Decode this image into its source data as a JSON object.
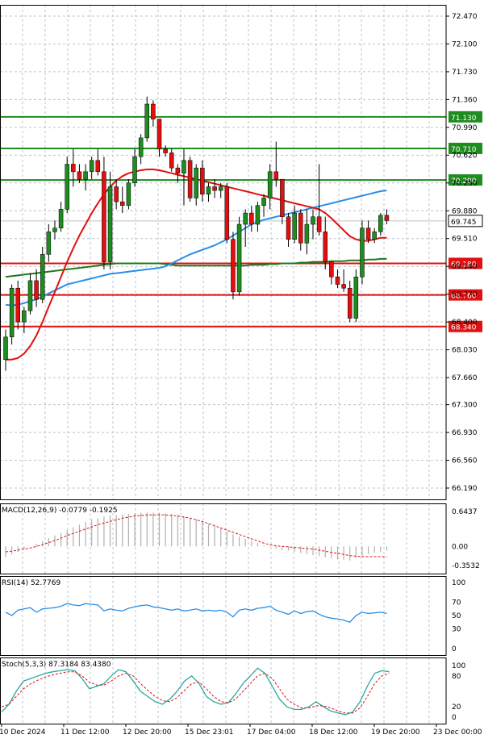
{
  "chart_data": {
    "type": "candlestick",
    "main": {
      "ylim": [
        66.19,
        72.47
      ],
      "y_ticks": [
        "72.470",
        "72.100",
        "71.730",
        "71.360",
        "70.990",
        "70.620",
        "70.250",
        "69.880",
        "69.510",
        "69.140",
        "68.770",
        "68.400",
        "68.030",
        "67.660",
        "67.300",
        "66.930",
        "66.560",
        "66.190"
      ],
      "x_labels": [
        "10 Dec 2024",
        "11 Dec 12:00",
        "12 Dec 20:00",
        "15 Dec 23:01",
        "17 Dec 04:00",
        "18 Dec 12:00",
        "19 Dec 20:00",
        "23 Dec 00:00"
      ],
      "x_label_index": [
        0,
        11,
        22,
        33,
        44,
        55,
        66,
        77
      ],
      "current_price": "69.745",
      "levels": [
        {
          "label": "71.130",
          "value": 71.13,
          "color": "#1e8c1e"
        },
        {
          "label": "70.710",
          "value": 70.71,
          "color": "#1e8c1e"
        },
        {
          "label": "70.290",
          "value": 70.29,
          "color": "#1e8c1e"
        },
        {
          "label": "69.180",
          "value": 69.18,
          "color": "#e01010"
        },
        {
          "label": "68.760",
          "value": 68.76,
          "color": "#e01010"
        },
        {
          "label": "68.340",
          "value": 68.34,
          "color": "#e01010"
        }
      ],
      "candles": [
        [
          67.9,
          68.3,
          67.75,
          68.2
        ],
        [
          68.2,
          68.9,
          68.1,
          68.85
        ],
        [
          68.85,
          68.95,
          68.3,
          68.4
        ],
        [
          68.4,
          68.6,
          68.25,
          68.55
        ],
        [
          68.55,
          69.05,
          68.5,
          68.95
        ],
        [
          68.95,
          69.1,
          68.6,
          68.7
        ],
        [
          68.7,
          69.4,
          68.65,
          69.3
        ],
        [
          69.3,
          69.7,
          69.2,
          69.6
        ],
        [
          69.6,
          69.75,
          69.5,
          69.65
        ],
        [
          69.65,
          70.0,
          69.6,
          69.9
        ],
        [
          69.9,
          70.6,
          69.85,
          70.5
        ],
        [
          70.5,
          70.7,
          70.2,
          70.4
        ],
        [
          70.4,
          70.5,
          70.25,
          70.3
        ],
        [
          70.3,
          70.5,
          70.15,
          70.4
        ],
        [
          70.4,
          70.6,
          70.3,
          70.55
        ],
        [
          70.55,
          70.7,
          70.35,
          70.4
        ],
        [
          70.4,
          70.6,
          69.1,
          69.2
        ],
        [
          69.2,
          70.4,
          69.1,
          70.2
        ],
        [
          70.2,
          70.3,
          69.9,
          70.0
        ],
        [
          70.0,
          70.2,
          69.85,
          69.95
        ],
        [
          69.95,
          70.3,
          69.9,
          70.25
        ],
        [
          70.25,
          70.7,
          70.2,
          70.6
        ],
        [
          70.6,
          70.9,
          70.5,
          70.85
        ],
        [
          70.85,
          71.4,
          70.8,
          71.3
        ],
        [
          71.3,
          71.35,
          71.0,
          71.1
        ],
        [
          71.1,
          71.0,
          70.6,
          70.7
        ],
        [
          70.7,
          70.75,
          70.6,
          70.65
        ],
        [
          70.65,
          70.7,
          70.4,
          70.45
        ],
        [
          70.45,
          70.5,
          70.25,
          70.38
        ],
        [
          70.38,
          70.7,
          69.95,
          70.55
        ],
        [
          70.55,
          70.6,
          70.0,
          70.05
        ],
        [
          70.05,
          70.5,
          69.95,
          70.45
        ],
        [
          70.45,
          70.55,
          70.0,
          70.1
        ],
        [
          70.1,
          70.25,
          70.0,
          70.2
        ],
        [
          70.2,
          70.3,
          70.05,
          70.15
        ],
        [
          70.15,
          70.25,
          70.05,
          70.2
        ],
        [
          70.2,
          70.25,
          69.45,
          69.5
        ],
        [
          69.5,
          69.6,
          68.7,
          68.8
        ],
        [
          68.8,
          69.8,
          68.75,
          69.7
        ],
        [
          69.7,
          69.9,
          69.4,
          69.85
        ],
        [
          69.85,
          69.95,
          69.6,
          69.7
        ],
        [
          69.7,
          70.0,
          69.6,
          69.95
        ],
        [
          69.95,
          70.1,
          69.8,
          70.05
        ],
        [
          70.05,
          70.5,
          69.9,
          70.4
        ],
        [
          70.4,
          70.8,
          70.2,
          70.3
        ],
        [
          70.3,
          70.3,
          69.7,
          69.8
        ],
        [
          69.8,
          69.85,
          69.4,
          69.5
        ],
        [
          69.5,
          69.95,
          69.45,
          69.85
        ],
        [
          69.85,
          69.9,
          69.35,
          69.45
        ],
        [
          69.45,
          69.9,
          69.3,
          69.7
        ],
        [
          69.7,
          69.9,
          69.5,
          69.8
        ],
        [
          69.8,
          70.5,
          69.55,
          69.6
        ],
        [
          69.6,
          69.8,
          69.1,
          69.2
        ],
        [
          69.2,
          69.2,
          68.9,
          69.0
        ],
        [
          69.0,
          69.1,
          68.85,
          68.9
        ],
        [
          68.9,
          69.1,
          68.8,
          68.85
        ],
        [
          68.85,
          68.95,
          68.4,
          68.45
        ],
        [
          68.45,
          69.1,
          68.4,
          69.0
        ],
        [
          69.0,
          69.75,
          68.9,
          69.65
        ],
        [
          69.65,
          69.75,
          69.45,
          69.5
        ],
        [
          69.5,
          69.65,
          69.45,
          69.6
        ],
        [
          69.6,
          69.85,
          69.55,
          69.82
        ],
        [
          69.82,
          69.9,
          69.7,
          69.75
        ]
      ],
      "ma_blue": [
        68.63,
        68.62,
        68.63,
        68.65,
        68.68,
        68.7,
        68.74,
        68.78,
        68.82,
        68.86,
        68.9,
        68.92,
        68.94,
        68.96,
        68.98,
        69.0,
        69.02,
        69.04,
        69.05,
        69.06,
        69.07,
        69.08,
        69.09,
        69.1,
        69.11,
        69.12,
        69.14,
        69.18,
        69.22,
        69.26,
        69.3,
        69.33,
        69.36,
        69.39,
        69.42,
        69.46,
        69.5,
        69.55,
        69.6,
        69.65,
        69.7,
        69.73,
        69.76,
        69.78,
        69.8,
        69.82,
        69.84,
        69.86,
        69.88,
        69.9,
        69.92,
        69.94,
        69.96,
        69.98,
        70.0,
        70.02,
        70.04,
        70.06,
        70.08,
        70.1,
        70.12,
        70.14,
        70.15
      ],
      "ma_red": [
        67.9,
        67.9,
        67.92,
        67.98,
        68.08,
        68.22,
        68.4,
        68.6,
        68.8,
        69.0,
        69.2,
        69.38,
        69.55,
        69.7,
        69.85,
        69.98,
        70.1,
        70.2,
        70.28,
        70.34,
        70.38,
        70.4,
        70.42,
        70.43,
        70.43,
        70.42,
        70.4,
        70.38,
        70.36,
        70.34,
        70.32,
        70.3,
        70.28,
        70.26,
        70.24,
        70.22,
        70.2,
        70.18,
        70.16,
        70.14,
        70.12,
        70.1,
        70.08,
        70.06,
        70.04,
        70.02,
        70.0,
        69.98,
        69.96,
        69.94,
        69.92,
        69.9,
        69.85,
        69.78,
        69.7,
        69.62,
        69.54,
        69.5,
        69.48,
        69.48,
        69.5,
        69.52,
        69.52
      ],
      "ma_green": [
        69.0,
        69.01,
        69.02,
        69.03,
        69.04,
        69.05,
        69.06,
        69.07,
        69.08,
        69.09,
        69.1,
        69.11,
        69.12,
        69.13,
        69.14,
        69.15,
        69.16,
        69.17,
        69.18,
        69.18,
        69.18,
        69.18,
        69.18,
        69.18,
        69.18,
        69.18,
        69.17,
        69.16,
        69.15,
        69.15,
        69.15,
        69.15,
        69.15,
        69.15,
        69.15,
        69.15,
        69.15,
        69.15,
        69.15,
        69.15,
        69.16,
        69.16,
        69.16,
        69.17,
        69.17,
        69.18,
        69.18,
        69.18,
        69.19,
        69.19,
        69.2,
        69.2,
        69.2,
        69.21,
        69.21,
        69.21,
        69.22,
        69.22,
        69.22,
        69.23,
        69.23,
        69.24,
        69.24
      ]
    },
    "macd": {
      "label": "MACD(12,26,9) -0.0779 -0.1925",
      "ylim": [
        -0.3532,
        0.6437
      ],
      "y_ticks": [
        "0.6437",
        "0.00",
        "-0.3532"
      ],
      "hist": [
        -0.2,
        -0.15,
        -0.1,
        -0.05,
        0.0,
        0.05,
        0.1,
        0.15,
        0.2,
        0.25,
        0.3,
        0.35,
        0.4,
        0.45,
        0.5,
        0.52,
        0.55,
        0.57,
        0.58,
        0.59,
        0.6,
        0.61,
        0.62,
        0.62,
        0.62,
        0.62,
        0.61,
        0.6,
        0.58,
        0.56,
        0.53,
        0.5,
        0.46,
        0.42,
        0.38,
        0.33,
        0.28,
        0.22,
        0.18,
        0.14,
        0.1,
        0.06,
        0.02,
        -0.01,
        -0.04,
        -0.06,
        -0.08,
        -0.1,
        -0.12,
        -0.14,
        -0.16,
        -0.18,
        -0.2,
        -0.22,
        -0.24,
        -0.25,
        -0.26,
        -0.22,
        -0.18,
        -0.14,
        -0.12,
        -0.1,
        -0.08
      ],
      "signal": [
        -0.1,
        -0.09,
        -0.07,
        -0.05,
        -0.03,
        0.0,
        0.03,
        0.07,
        0.11,
        0.15,
        0.2,
        0.24,
        0.28,
        0.32,
        0.36,
        0.4,
        0.43,
        0.46,
        0.49,
        0.52,
        0.54,
        0.56,
        0.57,
        0.58,
        0.58,
        0.58,
        0.58,
        0.57,
        0.56,
        0.54,
        0.52,
        0.49,
        0.46,
        0.42,
        0.38,
        0.34,
        0.3,
        0.26,
        0.22,
        0.18,
        0.14,
        0.1,
        0.06,
        0.03,
        0.01,
        0.0,
        -0.01,
        -0.02,
        -0.03,
        -0.04,
        -0.05,
        -0.07,
        -0.09,
        -0.11,
        -0.13,
        -0.15,
        -0.17,
        -0.18,
        -0.19,
        -0.19,
        -0.19,
        -0.19,
        -0.19
      ]
    },
    "rsi": {
      "label": "RSI(14) 52.7769",
      "ylim": [
        0,
        100
      ],
      "y_ticks": [
        "100",
        "70",
        "50",
        "30",
        "0"
      ],
      "values": [
        55,
        50,
        58,
        60,
        62,
        55,
        60,
        61,
        62,
        64,
        68,
        66,
        65,
        68,
        67,
        66,
        57,
        60,
        58,
        57,
        61,
        63,
        65,
        66,
        63,
        62,
        60,
        58,
        60,
        57,
        58,
        60,
        57,
        58,
        57,
        58,
        55,
        48,
        58,
        60,
        58,
        61,
        62,
        64,
        58,
        55,
        52,
        57,
        53,
        56,
        57,
        52,
        48,
        46,
        45,
        43,
        40,
        50,
        55,
        53,
        54,
        55,
        53
      ]
    },
    "stoch": {
      "label": "Stoch(5,3,3) 87.3184 83.4380",
      "ylim": [
        0,
        100
      ],
      "y_ticks": [
        "100",
        "80",
        "20",
        "0"
      ],
      "k": [
        10,
        25,
        50,
        70,
        75,
        80,
        85,
        88,
        90,
        92,
        90,
        75,
        55,
        60,
        65,
        80,
        92,
        88,
        70,
        50,
        40,
        30,
        25,
        35,
        50,
        70,
        80,
        65,
        40,
        30,
        25,
        28,
        45,
        65,
        80,
        95,
        85,
        60,
        35,
        20,
        15,
        15,
        20,
        30,
        20,
        12,
        8,
        5,
        10,
        30,
        60,
        85,
        90,
        88
      ],
      "d": [
        20,
        25,
        40,
        55,
        65,
        72,
        78,
        82,
        85,
        88,
        88,
        80,
        68,
        62,
        62,
        70,
        80,
        85,
        80,
        65,
        52,
        40,
        32,
        30,
        38,
        52,
        65,
        68,
        55,
        40,
        30,
        28,
        35,
        50,
        65,
        80,
        85,
        75,
        55,
        35,
        25,
        18,
        18,
        22,
        22,
        18,
        12,
        8,
        8,
        18,
        40,
        65,
        80,
        85
      ]
    }
  }
}
